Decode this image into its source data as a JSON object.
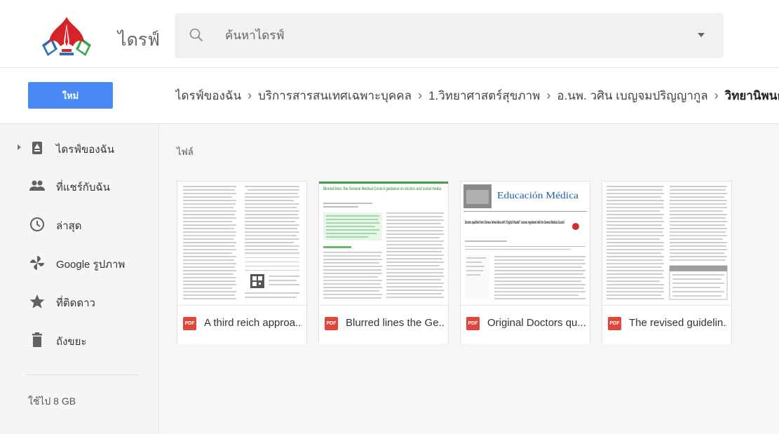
{
  "header": {
    "app_title": "ไดรฟ์",
    "search": {
      "placeholder": "ค้นหาไดรฟ์"
    }
  },
  "toolbar": {
    "new_label": "ใหม่"
  },
  "breadcrumb": [
    "ไดรฟ์ของฉัน",
    "บริการสารสนเทศเฉพาะบุคคล",
    "1.วิทยาศาสตร์สุขภาพ",
    "อ.นพ. วศิน เบญจมปริญญากูล",
    "วิทยานิพนธ์"
  ],
  "breadcrumb_separator": "›",
  "sidebar": {
    "items": [
      {
        "label": "ไดรฟ์ของฉัน",
        "icon": "drive-icon"
      },
      {
        "label": "ที่แชร์กับฉัน",
        "icon": "shared-people-icon"
      },
      {
        "label": "ล่าสุด",
        "icon": "clock-icon"
      },
      {
        "label": "Google รูปภาพ",
        "icon": "pinwheel-icon"
      },
      {
        "label": "ที่ติดดาว",
        "icon": "star-icon"
      },
      {
        "label": "ถังขยะ",
        "icon": "trash-icon"
      }
    ],
    "storage_text": "ใช้ไป 8 GB"
  },
  "main": {
    "section_label": "ไฟล์",
    "files": [
      {
        "name": "A third reich approa...",
        "type_badge": "PDF"
      },
      {
        "name": "Blurred lines the Ge...",
        "type_badge": "PDF",
        "preview_title": "Blurred lines: the General Medical Council guidance on doctors and social media"
      },
      {
        "name": "Original Doctors qu...",
        "type_badge": "PDF",
        "preview_journal": "Educación Médica",
        "preview_title": "Doctors qualified from Chinese Universities with \"English Parallel\" courses registered with the General Medical Council"
      },
      {
        "name": "The revised guidelin...",
        "type_badge": "PDF"
      }
    ]
  },
  "colors": {
    "new_button": "#4a8af4",
    "pdf_badge": "#e0463a",
    "sidebar_bg": "#f5f5f5",
    "logo_red": "#d6232a",
    "logo_green": "#3aa74a",
    "logo_blue": "#2f6fb7"
  }
}
